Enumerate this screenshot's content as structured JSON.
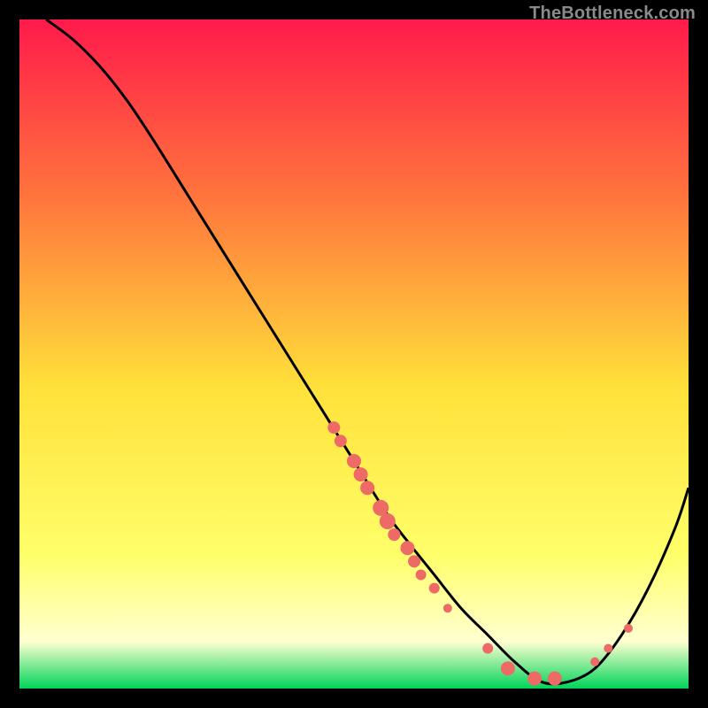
{
  "watermark": "TheBottleneck.com",
  "chart_data": {
    "type": "line",
    "title": "",
    "xlabel": "",
    "ylabel": "",
    "xlim": [
      0,
      100
    ],
    "ylim": [
      0,
      100
    ],
    "grid": false,
    "gradient": {
      "top": "#ff1a4b",
      "mid_upper": "#ff7a3c",
      "mid": "#ffe13a",
      "mid_lower": "#ffff6a",
      "lower": "#ffffd0",
      "bottom": "#00d45a"
    },
    "curve": {
      "description": "Bottleneck-style valley curve: steep descent from upper-left, minimum near x≈78, rise again toward right edge",
      "x": [
        4,
        8,
        12,
        16,
        20,
        25,
        30,
        35,
        40,
        45,
        50,
        55,
        58,
        62,
        66,
        70,
        74,
        78,
        82,
        86,
        90,
        94,
        98,
        100
      ],
      "y": [
        100,
        97,
        93,
        88,
        82,
        74,
        66,
        58,
        50,
        42,
        34,
        26,
        22,
        17,
        12,
        8,
        4,
        1,
        1,
        3,
        8,
        15,
        24,
        30
      ]
    },
    "markers": {
      "description": "Salmon-colored scatter points clustered along the curve, dense on the descending slope between y≈40 and y≈10, sparse near the minimum and on the ascending side",
      "color": "#ed6a66",
      "points": [
        {
          "x": 47,
          "y": 39,
          "r": 7
        },
        {
          "x": 48,
          "y": 37,
          "r": 7
        },
        {
          "x": 50,
          "y": 34,
          "r": 8
        },
        {
          "x": 51,
          "y": 32,
          "r": 8
        },
        {
          "x": 52,
          "y": 30,
          "r": 8
        },
        {
          "x": 54,
          "y": 27,
          "r": 9
        },
        {
          "x": 55,
          "y": 25,
          "r": 9
        },
        {
          "x": 56,
          "y": 23,
          "r": 7
        },
        {
          "x": 58,
          "y": 21,
          "r": 8
        },
        {
          "x": 59,
          "y": 19,
          "r": 7
        },
        {
          "x": 60,
          "y": 17,
          "r": 6
        },
        {
          "x": 62,
          "y": 15,
          "r": 6
        },
        {
          "x": 64,
          "y": 12,
          "r": 5
        },
        {
          "x": 70,
          "y": 6,
          "r": 6
        },
        {
          "x": 73,
          "y": 3,
          "r": 8
        },
        {
          "x": 77,
          "y": 1.5,
          "r": 8
        },
        {
          "x": 80,
          "y": 1.5,
          "r": 8
        },
        {
          "x": 86,
          "y": 4,
          "r": 5
        },
        {
          "x": 88,
          "y": 6,
          "r": 5
        },
        {
          "x": 91,
          "y": 9,
          "r": 5
        }
      ]
    }
  }
}
